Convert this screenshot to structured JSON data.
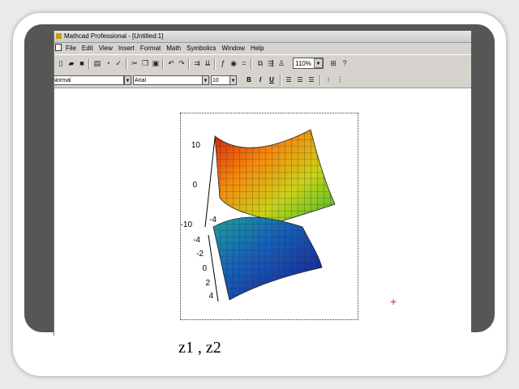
{
  "window": {
    "title": "Mathcad Professional - [Untitled:1]"
  },
  "menu": [
    "File",
    "Edit",
    "View",
    "Insert",
    "Format",
    "Math",
    "Symbolics",
    "Window",
    "Help"
  ],
  "toolbar": {
    "zoom": "110%"
  },
  "formatbar": {
    "style": "Normal",
    "font": "Arial",
    "size": "10",
    "bold": "B",
    "italic": "I",
    "underline": "U"
  },
  "plot": {
    "z_ticks": [
      "10",
      "0",
      "-10"
    ],
    "x_ticks": [
      "-4",
      "-4",
      "-2",
      "0",
      "2",
      "4"
    ],
    "label": "z1 , z2"
  },
  "colors": {
    "slide_band": "#565656",
    "cross_marker": "#e03030"
  }
}
